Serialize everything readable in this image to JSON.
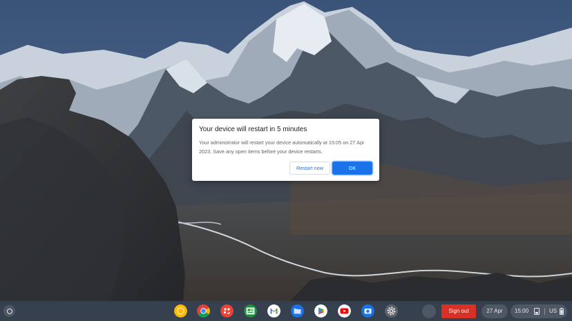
{
  "dialog": {
    "title": "Your device will restart in 5 minutes",
    "body": "Your administrator will restart your device automatically at 15:05 on 27 Apr 2023. Save any open items before your device restarts.",
    "restart_label": "Restart now",
    "ok_label": "OK"
  },
  "shelf": {
    "apps": [
      {
        "name": "Keep Notes",
        "icon": "keep-icon",
        "color": "#fbbc04"
      },
      {
        "name": "Chrome",
        "icon": "chrome-icon",
        "color": "#4285f4"
      },
      {
        "name": "Canvas",
        "icon": "palette-icon",
        "color": "#ea4335"
      },
      {
        "name": "Classroom",
        "icon": "classroom-icon",
        "color": "#1e8e3e"
      },
      {
        "name": "Gmail",
        "icon": "gmail-icon",
        "color": "#ea4335"
      },
      {
        "name": "Files",
        "icon": "files-icon",
        "color": "#1a73e8"
      },
      {
        "name": "Play Store",
        "icon": "play-store-icon",
        "color": "#34a853"
      },
      {
        "name": "YouTube",
        "icon": "youtube-icon",
        "color": "#ff0000"
      },
      {
        "name": "Camera",
        "icon": "camera-icon",
        "color": "#1a73e8"
      },
      {
        "name": "Settings",
        "icon": "settings-gear-icon",
        "color": "#5f6368"
      }
    ],
    "signout_label": "Sign out",
    "date": "27 Apr",
    "time": "15:00",
    "ime": "US"
  },
  "colors": {
    "accent": "#1a73e8",
    "signout": "#d93025"
  }
}
